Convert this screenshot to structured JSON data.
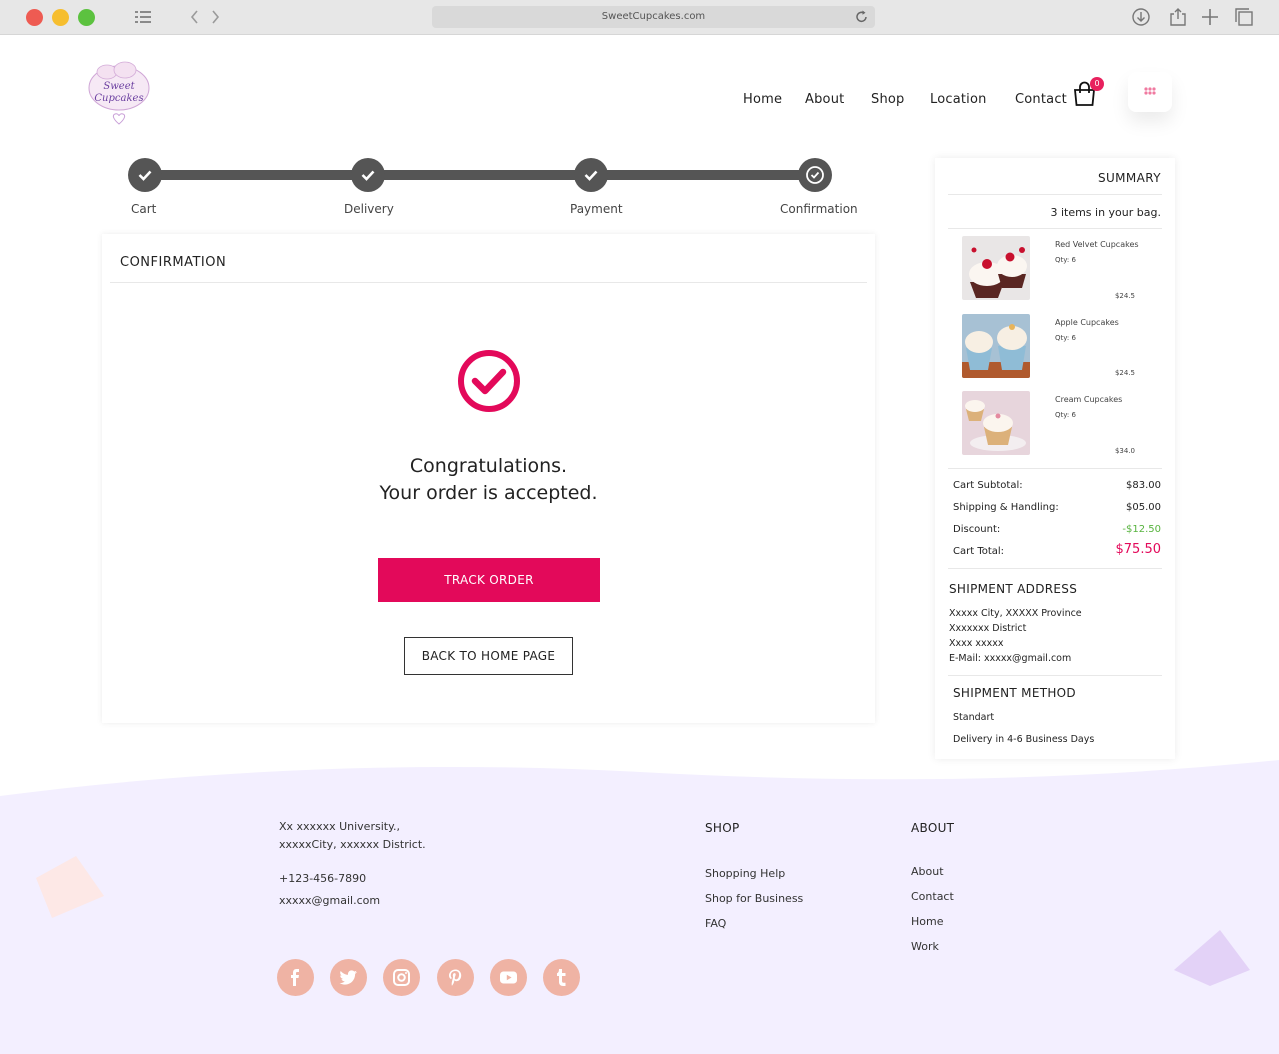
{
  "browser": {
    "url": "SweetCupcakes.com",
    "traffic_lights": [
      "close",
      "minimize",
      "zoom"
    ],
    "toolbar_icons": [
      "sidebar-icon",
      "back-icon",
      "forward-icon",
      "reload-icon",
      "download-icon",
      "share-icon",
      "new-tab-icon",
      "tabs-icon"
    ]
  },
  "brand": {
    "logo_line1": "Sweet",
    "logo_line2": "Cupcakes"
  },
  "nav": {
    "items": [
      "Home",
      "About",
      "Shop",
      "Location",
      "Contact"
    ],
    "cart_count": "0"
  },
  "steps": [
    {
      "label": "Cart",
      "state": "done"
    },
    {
      "label": "Delivery",
      "state": "done"
    },
    {
      "label": "Payment",
      "state": "done"
    },
    {
      "label": "Confirmation",
      "state": "current"
    }
  ],
  "confirmation": {
    "title": "CONFIRMATION",
    "line1": "Congratulations.",
    "line2": "Your order is accepted.",
    "track_button": "TRACK ORDER",
    "home_button": "BACK TO HOME PAGE"
  },
  "summary": {
    "title": "SUMMARY",
    "items_count": "3 items in your bag.",
    "items": [
      {
        "name": "Red Velvet Cupcakes",
        "qty": "Qty: 6",
        "price": "$24.5"
      },
      {
        "name": "Apple Cupcakes",
        "qty": "Qty: 6",
        "price": "$24.5"
      },
      {
        "name": "Cream Cupcakes",
        "qty": "Qty: 6",
        "price": "$34.0"
      }
    ],
    "totals": {
      "subtotal_label": "Cart Subtotal:",
      "subtotal": "$83.00",
      "shipping_label": "Shipping & Handling:",
      "shipping": "$05.00",
      "discount_label": "Discount:",
      "discount": "-$12.50",
      "total_label": "Cart Total:",
      "total": "$75.50"
    },
    "shipment_address": {
      "title": "SHIPMENT ADDRESS",
      "lines": [
        "Xxxxx City, XXXXX Province",
        "Xxxxxxx District",
        "Xxxx xxxxx",
        "E-Mail: xxxxx@gmail.com"
      ]
    },
    "shipment_method": {
      "title": "SHIPMENT METHOD",
      "method": "Standart",
      "delivery": "Delivery in 4-6 Business Days"
    }
  },
  "colors": {
    "accent": "#e3095a",
    "step_gray": "#555555",
    "discount_green": "#57b33e",
    "social_pink": "#efb3a4",
    "footer_lavender": "#f3efff"
  },
  "footer": {
    "address_line1": "Xx xxxxxx University.,",
    "address_line2": "xxxxxCity, xxxxxx District.",
    "phone": "+123-456-7890",
    "email": "xxxxx@gmail.com",
    "shop": {
      "title": "SHOP",
      "links": [
        "Shopping Help",
        "Shop for Business",
        "FAQ"
      ]
    },
    "about": {
      "title": "ABOUT",
      "links": [
        "About",
        "Contact",
        "Home",
        "Work"
      ]
    },
    "social": [
      "facebook-icon",
      "twitter-icon",
      "instagram-icon",
      "pinterest-icon",
      "youtube-icon",
      "tumblr-icon"
    ]
  }
}
